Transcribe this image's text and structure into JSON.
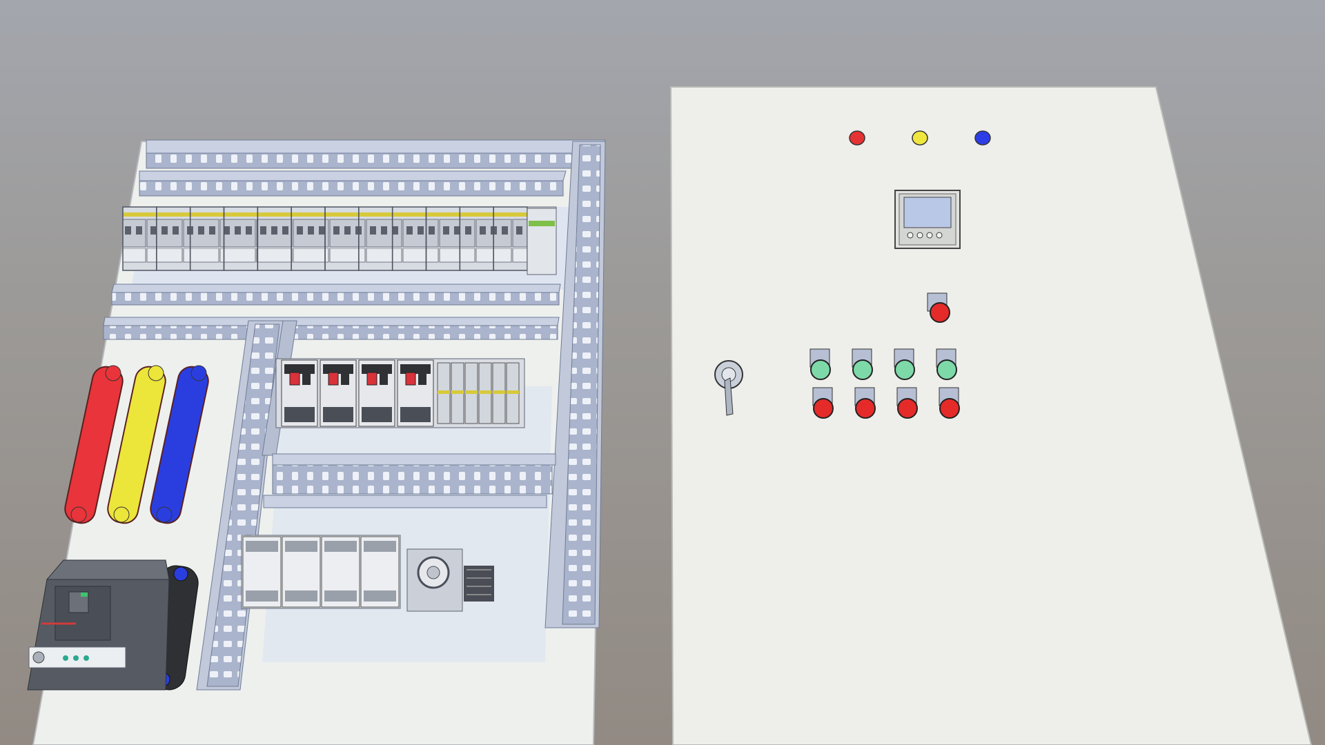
{
  "scene": {
    "background_top": "#a3a6ad",
    "background_bottom": "#928a83"
  },
  "mounting_plate": {
    "color": "#eef0ee",
    "breakers_top_row_count": 12,
    "terminal_blocks_count": 4,
    "busbars": [
      {
        "name": "L1",
        "color": "#e8343a"
      },
      {
        "name": "L2",
        "color": "#ece53a"
      },
      {
        "name": "L3",
        "color": "#2a3ee0"
      }
    ],
    "neutral_busbar_color": "#2f3034",
    "main_breaker_handle_color": "#4a4e56"
  },
  "door_panel": {
    "color": "#eeeeea",
    "pilot_lights": [
      {
        "name": "red",
        "color": "#e53232"
      },
      {
        "name": "yellow",
        "color": "#f0e640"
      },
      {
        "name": "blue",
        "color": "#2e3ee6"
      }
    ],
    "meter": {
      "screen_color": "#b8c8e6",
      "buttons": 4
    },
    "emergency_button_color": "#e52a2a",
    "start_buttons": {
      "count": 4,
      "color": "#7ed9a8"
    },
    "stop_buttons": {
      "count": 4,
      "color": "#e52a2a"
    },
    "door_handle": "rotary-handle-icon"
  }
}
